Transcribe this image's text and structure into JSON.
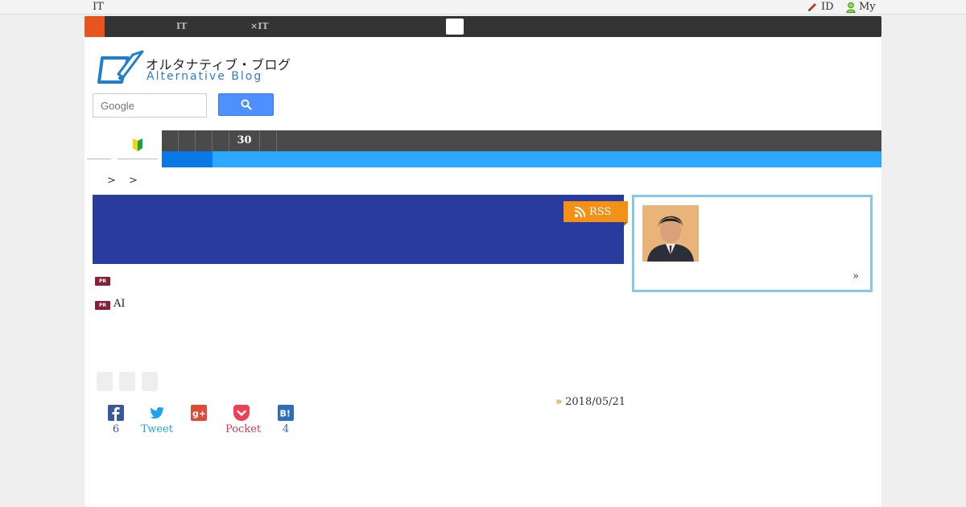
{
  "topbar": {
    "site_label": "IT",
    "id_link": "ID",
    "my_link": "My"
  },
  "ticker": {
    "items": [
      "  ",
      "IT ",
      "×IT  ",
      " "
    ]
  },
  "logo": {
    "jp_text": "オルタナティブ・ブログ",
    "en_text": "Alternative Blog"
  },
  "search": {
    "placeholder": "Google"
  },
  "nav": {
    "items": [
      "",
      "",
      "",
      "",
      "30",
      ""
    ]
  },
  "breadcrumb": {
    "text": "> >"
  },
  "blog_header": {
    "rss_label": "RSS"
  },
  "pr_items": [
    {
      "badge": "PR",
      "text": ""
    },
    {
      "badge": "PR",
      "text": "AI"
    }
  ],
  "article": {
    "date": "2018/05/21",
    "date_marker": "»"
  },
  "share": {
    "facebook_count": "6",
    "twitter_label": "Tweet",
    "pocket_label": "Pocket",
    "hatena_count": "4"
  },
  "profile": {
    "more_label": "»"
  },
  "colors": {
    "accent_orange": "#f39018",
    "header_blue": "#273c9c",
    "nav_dark": "#4a4a4a",
    "nav_light_blue": "#2ea7ff",
    "profile_border": "#86c8ec"
  }
}
